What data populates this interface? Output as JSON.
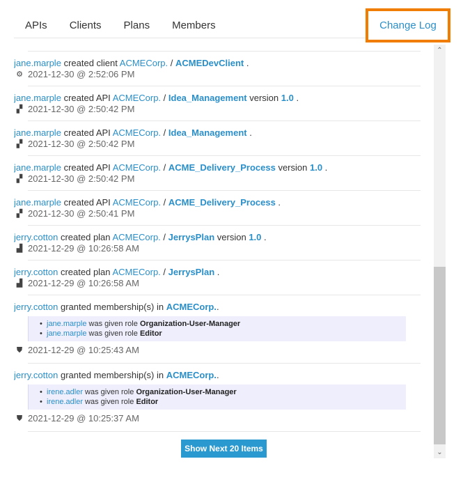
{
  "tabs": [
    "APIs",
    "Clients",
    "Plans",
    "Members"
  ],
  "active_tab": "Change Log",
  "entries": [
    {
      "actor": "jane.marple",
      "action": "created client",
      "org": "ACMECorp.",
      "target": "ACMEDevClient",
      "icon": "gears-icon",
      "date": "2021-12-30 @ 2:52:06 PM"
    },
    {
      "actor": "jane.marple",
      "action": "created API",
      "org": "ACMECorp.",
      "target": "Idea_Management",
      "version_word": "version",
      "version": "1.0",
      "icon": "puzzle-icon",
      "date": "2021-12-30 @ 2:50:42 PM"
    },
    {
      "actor": "jane.marple",
      "action": "created API",
      "org": "ACMECorp.",
      "target": "Idea_Management",
      "icon": "puzzle-icon",
      "date": "2021-12-30 @ 2:50:42 PM"
    },
    {
      "actor": "jane.marple",
      "action": "created API",
      "org": "ACMECorp.",
      "target": "ACME_Delivery_Process",
      "version_word": "version",
      "version": "1.0",
      "icon": "puzzle-icon",
      "date": "2021-12-30 @ 2:50:42 PM"
    },
    {
      "actor": "jane.marple",
      "action": "created API",
      "org": "ACMECorp.",
      "target": "ACME_Delivery_Process",
      "icon": "puzzle-icon",
      "date": "2021-12-30 @ 2:50:41 PM"
    },
    {
      "actor": "jerry.cotton",
      "action": "created plan",
      "org": "ACMECorp.",
      "target": "JerrysPlan",
      "version_word": "version",
      "version": "1.0",
      "icon": "bar-chart-icon",
      "date": "2021-12-29 @ 10:26:58 AM"
    },
    {
      "actor": "jerry.cotton",
      "action": "created plan",
      "org": "ACMECorp.",
      "target": "JerrysPlan",
      "icon": "bar-chart-icon",
      "date": "2021-12-29 @ 10:26:58 AM"
    }
  ],
  "memberships": [
    {
      "actor": "jerry.cotton",
      "action": "granted membership(s) in",
      "org": "ACMECorp.",
      "icon": "shield-icon",
      "date": "2021-12-29 @ 10:25:43 AM",
      "roles": [
        {
          "user": "jane.marple",
          "text": "was given role",
          "role": "Organization-User-Manager"
        },
        {
          "user": "jane.marple",
          "text": "was given role",
          "role": "Editor"
        }
      ]
    },
    {
      "actor": "jerry.cotton",
      "action": "granted membership(s) in",
      "org": "ACMECorp.",
      "icon": "shield-icon",
      "date": "2021-12-29 @ 10:25:37 AM",
      "roles": [
        {
          "user": "irene.adler",
          "text": "was given role",
          "role": "Organization-User-Manager"
        },
        {
          "user": "irene.adler",
          "text": "was given role",
          "role": "Editor"
        }
      ]
    }
  ],
  "show_more_label": "Show Next 20 Items"
}
